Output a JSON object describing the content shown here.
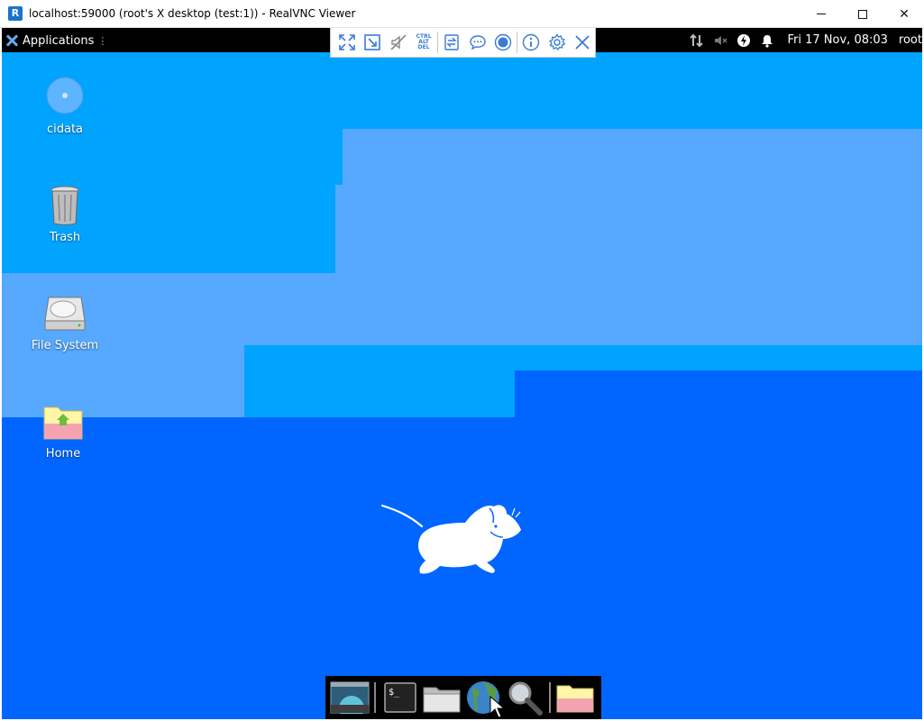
{
  "window": {
    "title": "localhost:59000 (root's X desktop (test:1)) - RealVNC Viewer",
    "app_icon_letter": "R",
    "controls": [
      "minimize",
      "maximize",
      "close"
    ],
    "close_glyph": "✕"
  },
  "panel": {
    "applications_label": "Applications",
    "applications_handle": "⋮",
    "tray_icons": [
      "network-icon",
      "volume-muted-icon",
      "power-icon",
      "notification-bell-icon"
    ],
    "clock": "Fri 17 Nov, 08:03",
    "user": "root"
  },
  "vnc_toolbar": {
    "buttons": [
      "fullscreen",
      "scale",
      "mute-audio",
      "ctrl-alt-del",
      "file-transfer",
      "chat",
      "record",
      "info",
      "settings",
      "close"
    ],
    "ctrl_alt_del_lines": [
      "CTRL",
      "ALT",
      "DEL"
    ],
    "accent": "#3a7bd5"
  },
  "desktop": {
    "icons": [
      {
        "label": "cidata",
        "icon": "disc-icon"
      },
      {
        "label": "Trash",
        "icon": "trash-icon"
      },
      {
        "label": "File System",
        "icon": "hard-drive-icon"
      },
      {
        "label": "Home",
        "icon": "home-folder-icon"
      }
    ],
    "colors": {
      "base": "#0066ff",
      "cyan": "#00a4ff",
      "light": "#57a8ff"
    }
  },
  "dock": {
    "items": [
      "show-desktop",
      "terminal",
      "file-manager",
      "web-browser",
      "search",
      "folder"
    ]
  }
}
